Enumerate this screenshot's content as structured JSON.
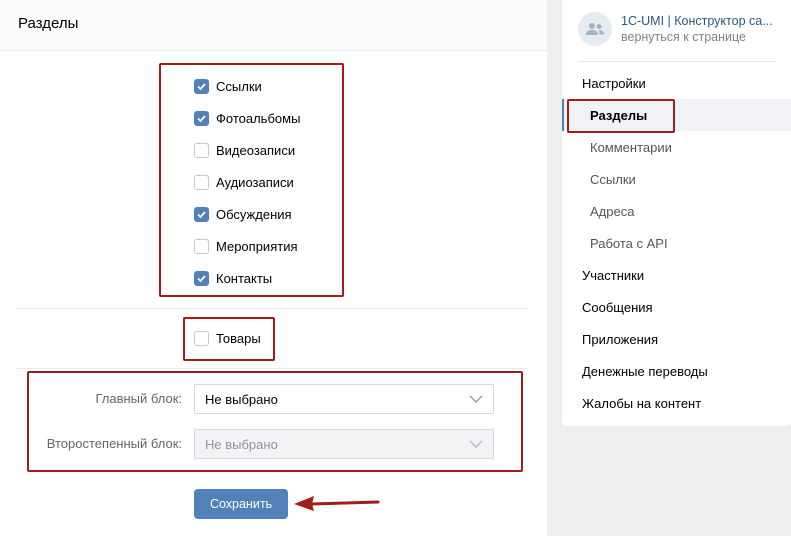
{
  "main": {
    "title": "Разделы",
    "sections": [
      {
        "label": "Ссылки",
        "checked": true
      },
      {
        "label": "Фотоальбомы",
        "checked": true
      },
      {
        "label": "Видеозаписи",
        "checked": false
      },
      {
        "label": "Аудиозаписи",
        "checked": false
      },
      {
        "label": "Обсуждения",
        "checked": true
      },
      {
        "label": "Мероприятия",
        "checked": false
      },
      {
        "label": "Контакты",
        "checked": true
      }
    ],
    "goods": {
      "label": "Товары",
      "checked": false
    },
    "main_block": {
      "label": "Главный блок:",
      "value": "Не выбрано"
    },
    "secondary_block": {
      "label": "Второстепенный блок:",
      "value": "Не выбрано"
    },
    "save_label": "Сохранить"
  },
  "sidebar": {
    "community_name": "1С-UMI | Конструктор са...",
    "back_link": "вернуться к странице",
    "menu": [
      {
        "label": "Настройки",
        "level": "top"
      },
      {
        "label": "Разделы",
        "level": "sub",
        "active": true
      },
      {
        "label": "Комментарии",
        "level": "sub"
      },
      {
        "label": "Ссылки",
        "level": "sub"
      },
      {
        "label": "Адреса",
        "level": "sub"
      },
      {
        "label": "Работа с API",
        "level": "sub"
      },
      {
        "label": "Участники",
        "level": "top"
      },
      {
        "label": "Сообщения",
        "level": "top"
      },
      {
        "label": "Приложения",
        "level": "top"
      },
      {
        "label": "Денежные переводы",
        "level": "top"
      },
      {
        "label": "Жалобы на контент",
        "level": "top"
      }
    ]
  },
  "colors": {
    "accent": "#5181b8",
    "highlight": "#a31c1c"
  }
}
